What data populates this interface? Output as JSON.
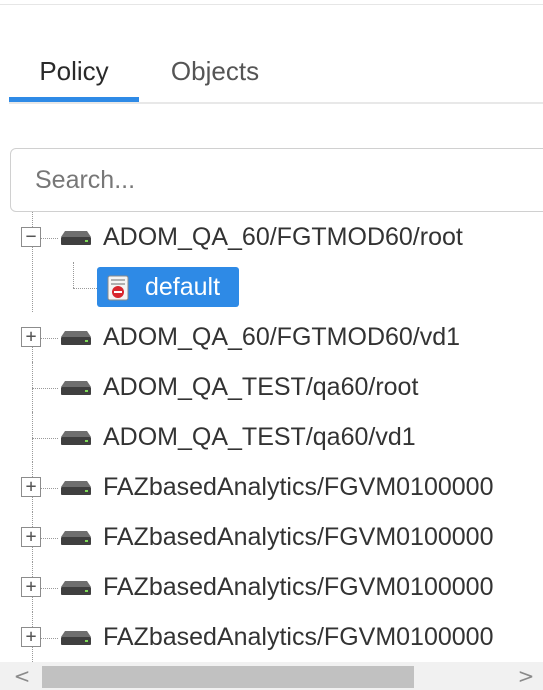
{
  "tabs": [
    {
      "label": "Policy",
      "active": true
    },
    {
      "label": "Objects",
      "active": false
    }
  ],
  "search": {
    "placeholder": "Search...",
    "value": ""
  },
  "tree": {
    "nodes": [
      {
        "label": "ADOM_QA_60/FGTMOD60/root",
        "toggle": "−",
        "expanded": true
      },
      {
        "label": "default",
        "selected": true,
        "child": true
      },
      {
        "label": "ADOM_QA_60/FGTMOD60/vd1",
        "toggle": "+"
      },
      {
        "label": "ADOM_QA_TEST/qa60/root"
      },
      {
        "label": "ADOM_QA_TEST/qa60/vd1"
      },
      {
        "label": "FAZbasedAnalytics/FGVM0100000",
        "toggle": "+"
      },
      {
        "label": "FAZbasedAnalytics/FGVM0100000",
        "toggle": "+"
      },
      {
        "label": "FAZbasedAnalytics/FGVM0100000",
        "toggle": "+"
      },
      {
        "label": "FAZbasedAnalytics/FGVM0100000",
        "toggle": "+"
      }
    ]
  },
  "scrollbar": {
    "left_arrow": "<",
    "right_arrow": ">"
  },
  "colors": {
    "accent": "#2e8ae6",
    "text": "#333333",
    "muted": "#777777"
  },
  "icons": {
    "device": "device-icon",
    "policy_package": "policy-package-icon",
    "expand": "plus-icon",
    "collapse": "minus-icon"
  }
}
